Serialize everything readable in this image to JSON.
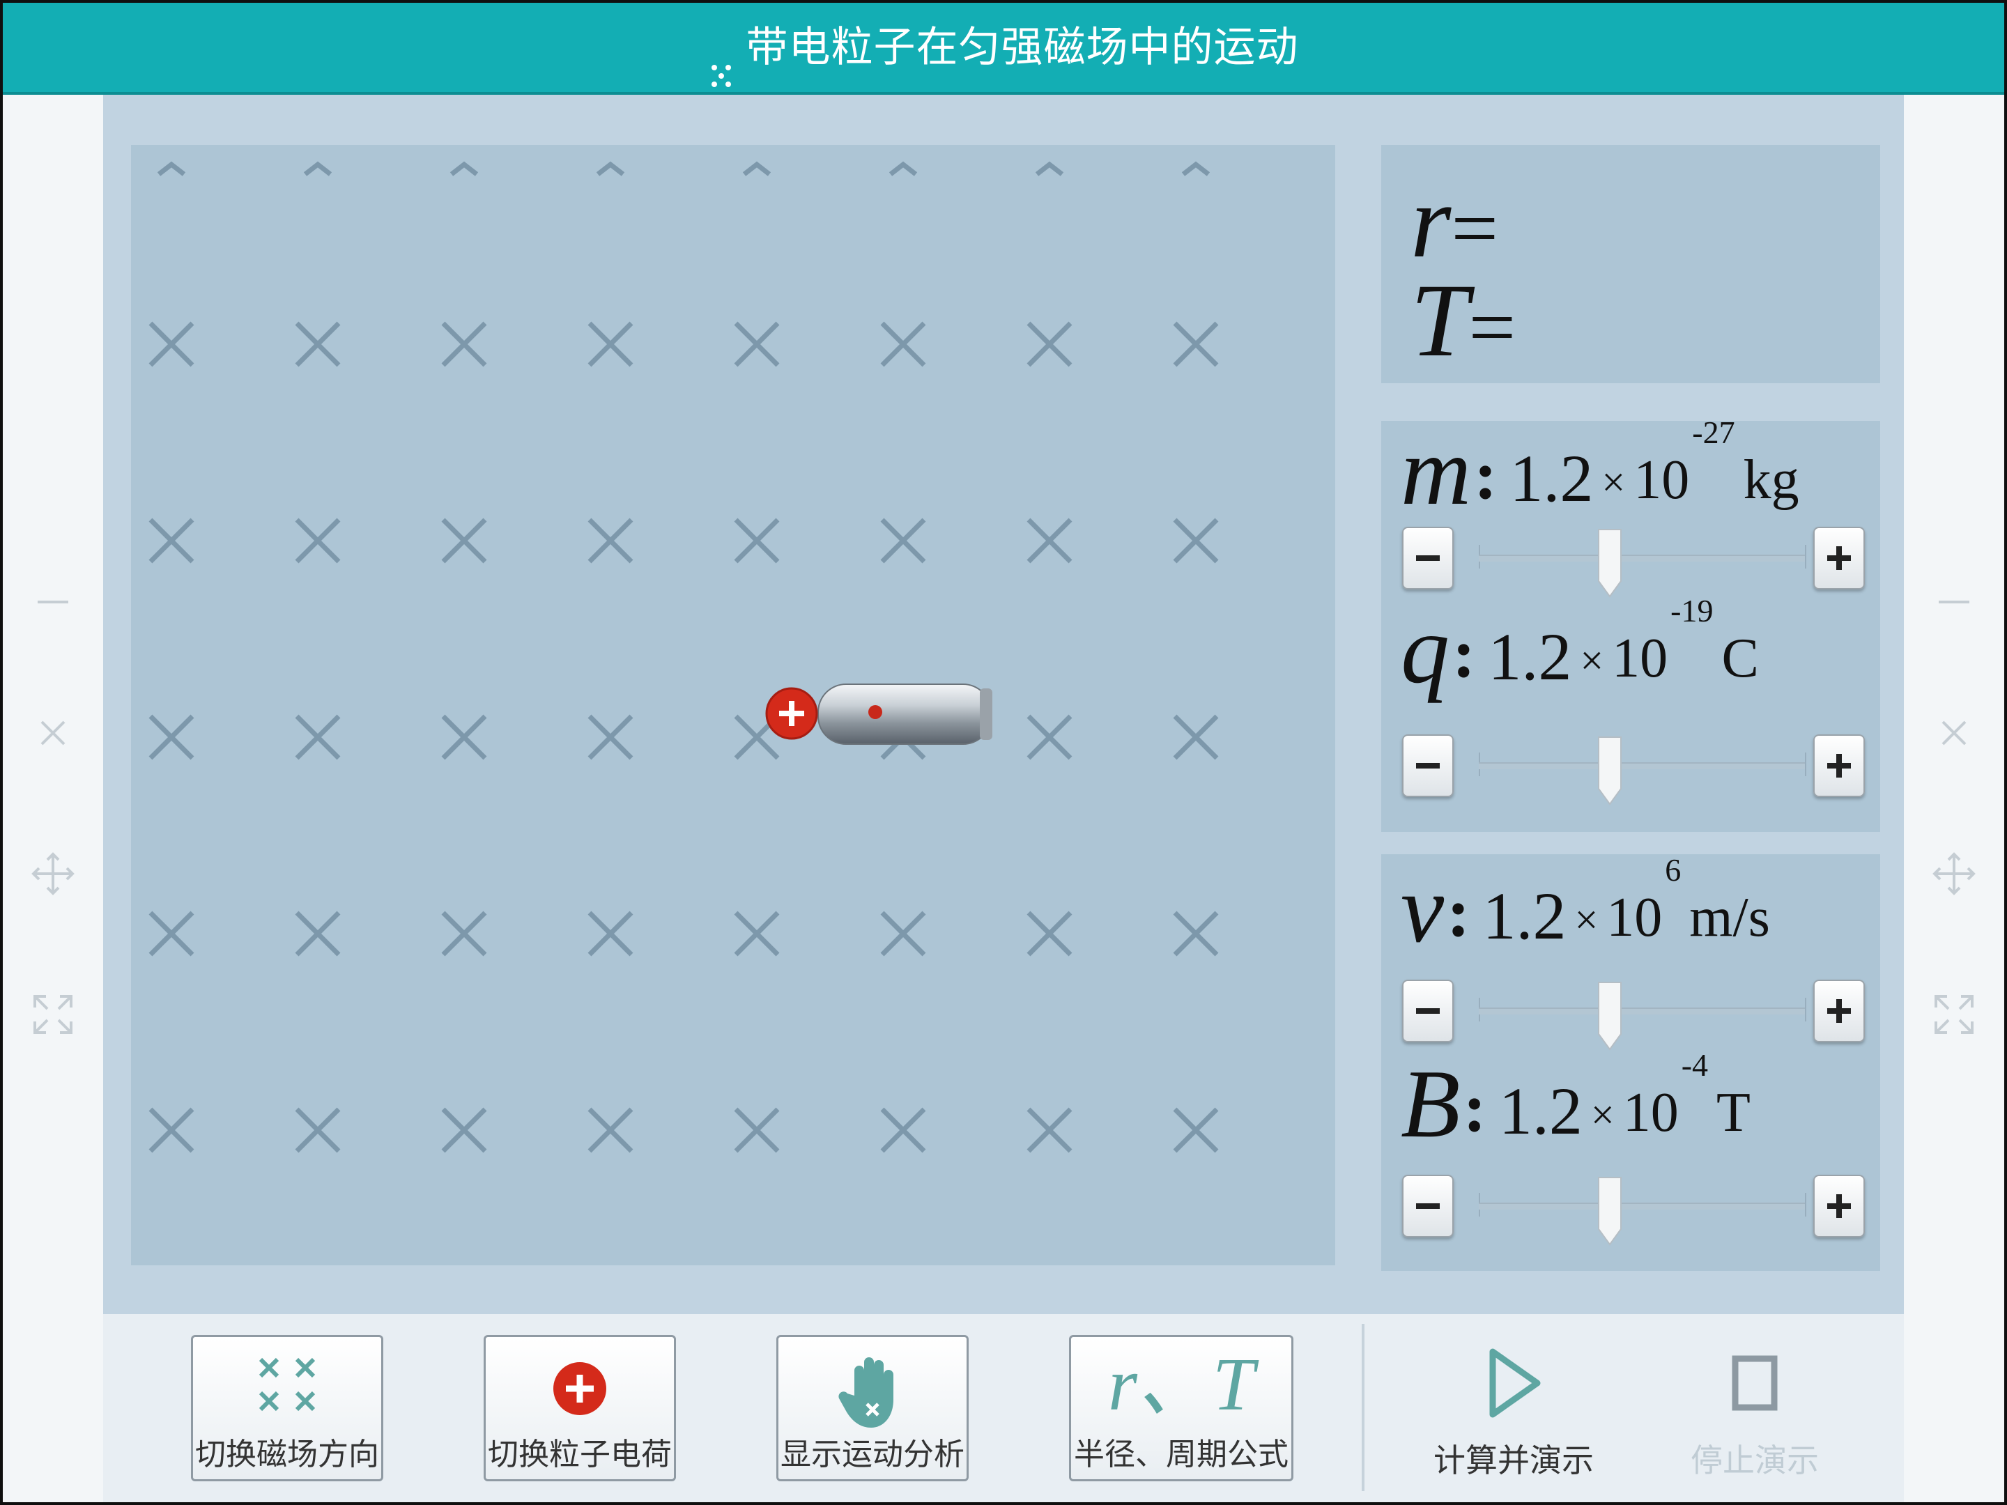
{
  "title": "带电粒子在匀强磁场中的运动",
  "colors": {
    "titlebar": "#13aeb4",
    "field_bg": "#adc5d5",
    "field_mark": "#7d98ab",
    "particle_charge": "#d42a1a",
    "accent": "#5ea6a2",
    "disabled": "#b8c6cf"
  },
  "results": {
    "r_label": "r",
    "t_label": "T",
    "equals": "="
  },
  "params": {
    "m": {
      "symbol": "m",
      "colon": ":",
      "mantissa": "1.2",
      "times": "×",
      "base": "10",
      "exponent": "-27",
      "unit": "kg",
      "slider_level": 0.4
    },
    "q": {
      "symbol": "q",
      "colon": ":",
      "mantissa": "1.2",
      "times": "×",
      "base": "10",
      "exponent": "-19",
      "unit": "C",
      "slider_level": 0.4
    },
    "v": {
      "symbol": "v",
      "colon": ":",
      "mantissa": "1.2",
      "times": "×",
      "base": "10",
      "exponent": "6",
      "unit": "m/s",
      "slider_level": 0.4
    },
    "B": {
      "symbol": "B",
      "colon": ":",
      "mantissa": "1.2",
      "times": "×",
      "base": "10",
      "exponent": "-4",
      "unit": "T",
      "slider_level": 0.4
    }
  },
  "field": {
    "direction": "into-page",
    "mark_symbol": "×",
    "columns": 8,
    "rows": 5
  },
  "particle": {
    "charge_symbol": "+",
    "icon": "particle-gun-icon"
  },
  "toolbar": {
    "toggle_field_label": "切换磁场方向",
    "toggle_charge_label": "切换粒子电荷",
    "motion_analysis_label": "显示运动分析",
    "formula_icon_text": "r、T",
    "formula_label": "半径、周期公式",
    "run_label": "计算并演示",
    "stop_label": "停止演示"
  },
  "rail_icons": [
    "minimize-icon",
    "close-icon",
    "move-icon",
    "fullscreen-icon"
  ]
}
